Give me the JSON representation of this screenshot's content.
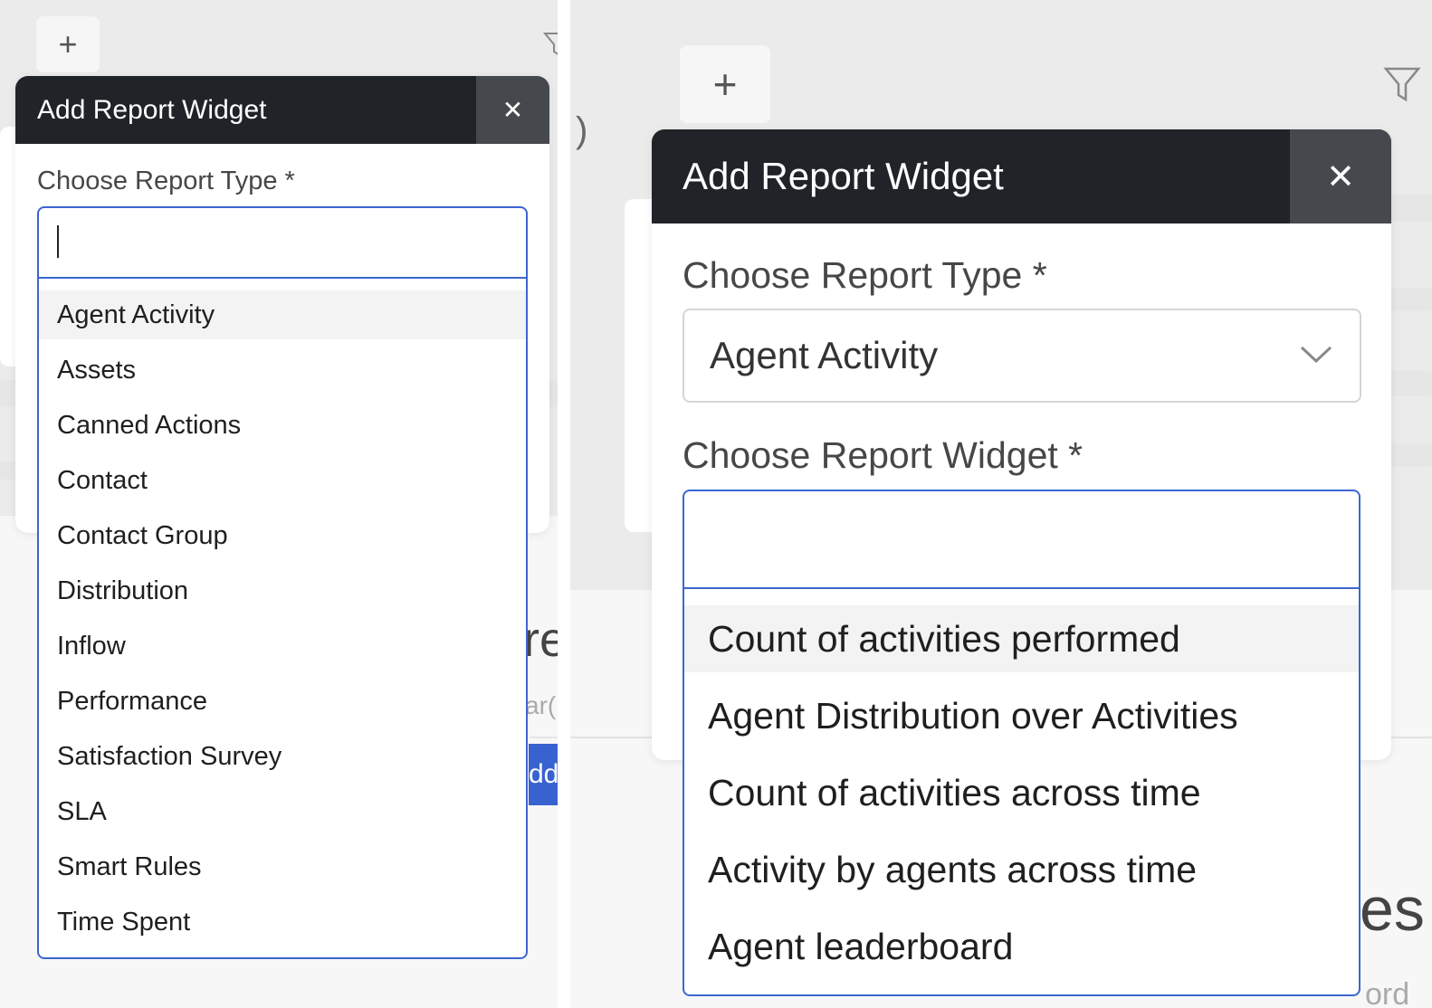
{
  "left_panel": {
    "plus_label": "+",
    "modal": {
      "title": "Add Report Widget",
      "close_label": "✕",
      "type_label": "Choose Report Type *",
      "search_value": "",
      "options": [
        "Agent Activity",
        "Assets",
        "Canned Actions",
        "Contact",
        "Contact Group",
        "Distribution",
        "Inflow",
        "Performance",
        "Satisfaction Survey",
        "SLA",
        "Smart Rules",
        "Time Spent"
      ],
      "highlighted_index": 0
    },
    "background": {
      "heading_fragment": "re",
      "search_fragment": "ar(",
      "button_fragment": "dd"
    }
  },
  "right_panel": {
    "plus_label": "+",
    "paren": ")",
    "modal": {
      "title": "Add Report Widget",
      "close_label": "✕",
      "type_label": "Choose Report Type *",
      "type_value": "Agent Activity",
      "widget_label": "Choose Report Widget *",
      "search_value": "",
      "options": [
        "Count of activities performed",
        "Agent Distribution over Activities",
        "Count of activities across time",
        "Activity by agents across time",
        "Agent leaderboard"
      ],
      "highlighted_index": 0
    },
    "background": {
      "heading_fragment": "es",
      "search_fragment": "ord"
    }
  },
  "icons": [
    "plus-icon",
    "filter-icon",
    "close-icon",
    "chevron-down-icon"
  ],
  "colors": {
    "header": "#202327",
    "close_bg": "#45484c",
    "focus_border": "#3c67d0",
    "accent_button": "#3762cf",
    "backdrop": "#ebebeb"
  }
}
